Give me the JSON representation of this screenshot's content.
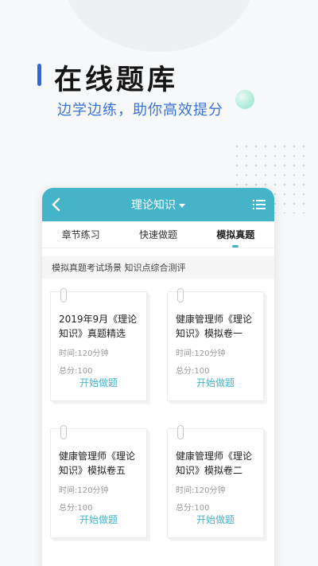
{
  "hero": {
    "title": "在线题库",
    "subtitle": "边学边练，助你高效提分"
  },
  "app": {
    "header_title": "理论知识",
    "icons": {
      "back": "chevron-left-icon",
      "dropdown": "caret-down-icon",
      "menu": "list-menu-icon"
    },
    "accent_color": "#45b3c8",
    "brand_color": "#2b6ad8"
  },
  "tabs": [
    {
      "label": "章节练习",
      "active": false
    },
    {
      "label": "快速做题",
      "active": false
    },
    {
      "label": "模拟真题",
      "active": true
    }
  ],
  "section_heading": "模拟真题考试场景 知识点综合测评",
  "papers": [
    {
      "title": "2019年9月《理论知识》真题精选",
      "time": "时间:120分钟",
      "score": "总分:100",
      "action": "开始做题"
    },
    {
      "title": "健康管理师《理论知识》模拟卷一",
      "time": "时间:120分钟",
      "score": "总分:100",
      "action": "开始做题"
    },
    {
      "title": "健康管理师《理论知识》模拟卷五",
      "time": "时间:120分钟",
      "score": "总分:100",
      "action": "开始做题"
    },
    {
      "title": "健康管理师《理论知识》模拟卷二",
      "time": "时间:120分钟",
      "score": "总分:100",
      "action": "开始做题"
    }
  ]
}
